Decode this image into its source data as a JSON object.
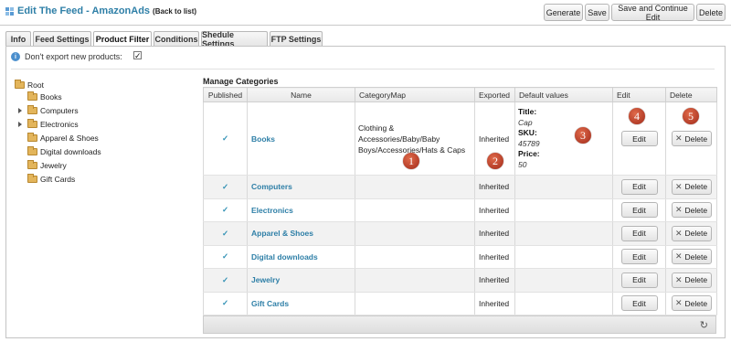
{
  "header": {
    "title": "Edit The Feed - AmazonAds",
    "back_link": "(Back to list)",
    "buttons": [
      "Generate",
      "Save",
      "Save and Continue Edit",
      "Delete"
    ]
  },
  "tabs": [
    {
      "label": "Info",
      "active": false
    },
    {
      "label": "Feed Settings",
      "active": false
    },
    {
      "label": "Product Filter",
      "active": true
    },
    {
      "label": "Conditions",
      "active": false
    },
    {
      "label": "Shedule Settings",
      "active": false
    },
    {
      "label": "FTP Settings",
      "active": false
    }
  ],
  "options": {
    "dont_export_label": "Don't export new products:",
    "dont_export_checked": true,
    "check_glyph": "✓"
  },
  "tree": {
    "root": "Root",
    "items": [
      {
        "label": "Books",
        "expandable": false
      },
      {
        "label": "Computers",
        "expandable": true
      },
      {
        "label": "Electronics",
        "expandable": true
      },
      {
        "label": "Apparel & Shoes",
        "expandable": false
      },
      {
        "label": "Digital downloads",
        "expandable": false
      },
      {
        "label": "Jewelry",
        "expandable": false
      },
      {
        "label": "Gift Cards",
        "expandable": false
      }
    ]
  },
  "manage": {
    "title": "Manage Categories",
    "columns": [
      "Published",
      "Name",
      "CategoryMap",
      "Exported",
      "Default values",
      "Edit",
      "Delete"
    ],
    "edit_label": "Edit",
    "delete_label": "Delete",
    "rows": [
      {
        "name": "Books",
        "category_map": "Clothing & Accessories/Baby/Baby Boys/Accessories/Hats & Caps",
        "exported": "Inherited",
        "defaults": [
          {
            "label": "Title:",
            "value": "Cap"
          },
          {
            "label": "SKU:",
            "value": "45789"
          },
          {
            "label": "Price:",
            "value": "50"
          }
        ]
      },
      {
        "name": "Computers",
        "category_map": "",
        "exported": "Inherited",
        "defaults": []
      },
      {
        "name": "Electronics",
        "category_map": "",
        "exported": "Inherited",
        "defaults": []
      },
      {
        "name": "Apparel & Shoes",
        "category_map": "",
        "exported": "Inherited",
        "defaults": []
      },
      {
        "name": "Digital downloads",
        "category_map": "",
        "exported": "Inherited",
        "defaults": []
      },
      {
        "name": "Jewelry",
        "category_map": "",
        "exported": "Inherited",
        "defaults": []
      },
      {
        "name": "Gift Cards",
        "category_map": "",
        "exported": "Inherited",
        "defaults": []
      }
    ]
  },
  "markers": [
    "1",
    "2",
    "3",
    "4",
    "5"
  ],
  "colors": {
    "accent": "#2e7fa7",
    "marker": "#b83a22",
    "check": "#2e8fb3"
  }
}
